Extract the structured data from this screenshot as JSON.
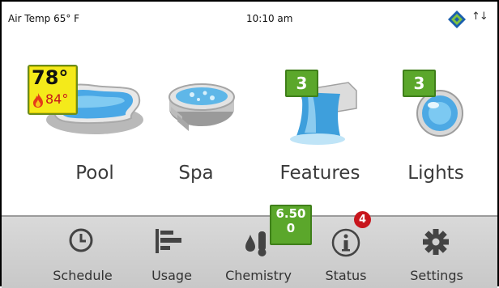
{
  "status": {
    "air_temp": "Air Temp 65° F",
    "time": "10:10 am",
    "network_arrows": "↑↓"
  },
  "tiles": [
    {
      "label": "Pool",
      "temp": "78°",
      "heat_setpoint": "84°"
    },
    {
      "label": "Spa"
    },
    {
      "label": "Features",
      "count": "3"
    },
    {
      "label": "Lights",
      "count": "3"
    }
  ],
  "nav": [
    {
      "label": "Schedule"
    },
    {
      "label": "Usage"
    },
    {
      "label": "Chemistry",
      "ph": "6.50",
      "orp": "0"
    },
    {
      "label": "Status",
      "alerts": "4"
    },
    {
      "label": "Settings"
    }
  ],
  "colors": {
    "badge_green": "#5ba72b",
    "badge_yellow": "#f4ea1a",
    "alert_red": "#c8161d",
    "navbar": "#d0d0d0"
  }
}
